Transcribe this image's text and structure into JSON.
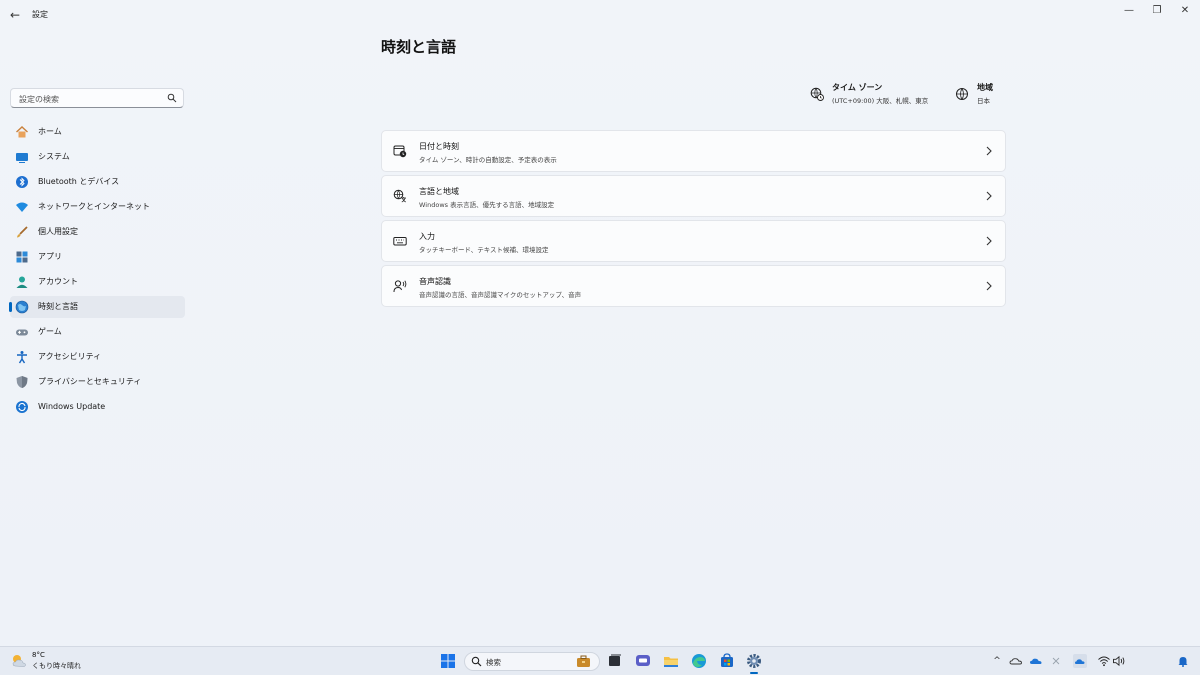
{
  "app": {
    "title": "設定",
    "back_glyph": "←",
    "controls": {
      "minimize": "—",
      "maximize": "❐",
      "close": "✕"
    }
  },
  "search": {
    "placeholder": "設定の検索",
    "icon": "search-icon"
  },
  "sidebar": {
    "items": [
      {
        "label": "ホーム",
        "icon": "home-icon",
        "active": false
      },
      {
        "label": "システム",
        "icon": "system-icon",
        "active": false
      },
      {
        "label": "Bluetooth とデバイス",
        "icon": "bluetooth-icon",
        "active": false
      },
      {
        "label": "ネットワークとインターネット",
        "icon": "wifi-icon",
        "active": false
      },
      {
        "label": "個人用設定",
        "icon": "brush-icon",
        "active": false
      },
      {
        "label": "アプリ",
        "icon": "apps-icon",
        "active": false
      },
      {
        "label": "アカウント",
        "icon": "account-icon",
        "active": false
      },
      {
        "label": "時刻と言語",
        "icon": "time-language-icon",
        "active": true
      },
      {
        "label": "ゲーム",
        "icon": "gamepad-icon",
        "active": false
      },
      {
        "label": "アクセシビリティ",
        "icon": "accessibility-icon",
        "active": false
      },
      {
        "label": "プライバシーとセキュリティ",
        "icon": "shield-icon",
        "active": false
      },
      {
        "label": "Windows Update",
        "icon": "update-icon",
        "active": false
      }
    ]
  },
  "main": {
    "title": "時刻と言語",
    "info": {
      "timezone": {
        "title": "タイム ゾーン",
        "value": "(UTC+09:00) 大阪、札幌、東京",
        "icon": "timezone-icon"
      },
      "region": {
        "title": "地域",
        "value": "日本",
        "icon": "globe-icon"
      }
    },
    "cards": [
      {
        "title": "日付と時刻",
        "subtitle": "タイム ゾーン、時計の自動設定、予定表の表示",
        "icon": "calendar-clock-icon"
      },
      {
        "title": "言語と地域",
        "subtitle": "Windows 表示言語、優先する言語、地域設定",
        "icon": "language-icon"
      },
      {
        "title": "入力",
        "subtitle": "タッチキーボード、テキスト候補、環境設定",
        "icon": "keyboard-icon"
      },
      {
        "title": "音声認識",
        "subtitle": "音声認識の言語、音声認識マイクのセットアップ、音声",
        "icon": "speech-icon"
      }
    ]
  },
  "taskbar": {
    "weather": {
      "temp": "8°C",
      "desc": "くもり時々晴れ",
      "icon": "weather-icon"
    },
    "search_label": "検索",
    "tray": {
      "chevron": "^"
    }
  },
  "colors": {
    "accent": "#0067c0",
    "window_bg": "#eef2f8",
    "card_bg": "#fbfcfd"
  }
}
